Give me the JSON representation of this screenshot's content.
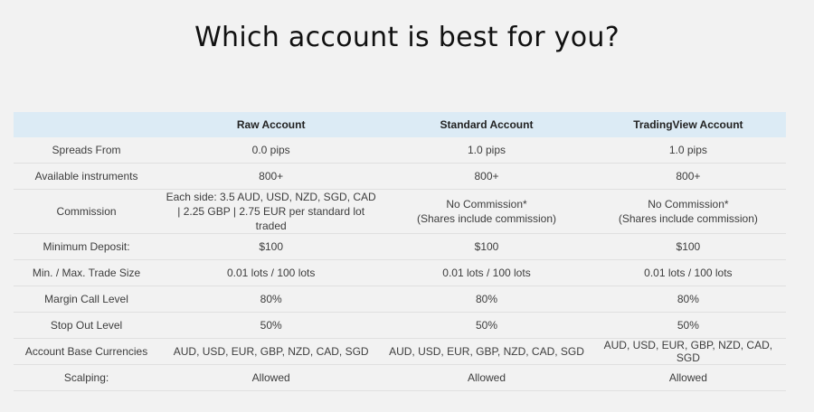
{
  "title": "Which account is best for you?",
  "table": {
    "headers": [
      "",
      "Raw Account",
      "Standard Account",
      "TradingView Account"
    ],
    "rows": [
      {
        "label": "Spreads From",
        "raw": "0.0 pips",
        "standard": "1.0 pips",
        "tradingview": "1.0 pips"
      },
      {
        "label": "Available instruments",
        "raw": "800+",
        "standard": "800+",
        "tradingview": "800+"
      },
      {
        "label": "Commission",
        "raw_lines": [
          "Each side: 3.5 AUD, USD, NZD, SGD, CAD",
          "| 2.25 GBP | 2.75 EUR per standard lot traded"
        ],
        "standard_lines": [
          "No Commission*",
          "(Shares include commission)"
        ],
        "tradingview_lines": [
          "No Commission*",
          "(Shares include commission)"
        ]
      },
      {
        "label": "Minimum Deposit:",
        "raw": "$100",
        "standard": "$100",
        "tradingview": "$100"
      },
      {
        "label": "Min. / Max. Trade Size",
        "raw": "0.01 lots / 100 lots",
        "standard": "0.01 lots / 100 lots",
        "tradingview": "0.01 lots / 100 lots"
      },
      {
        "label": "Margin Call Level",
        "raw": "80%",
        "standard": "80%",
        "tradingview": "80%"
      },
      {
        "label": "Stop Out Level",
        "raw": "50%",
        "standard": "50%",
        "tradingview": "50%"
      },
      {
        "label": "Account Base Currencies",
        "raw": "AUD, USD, EUR, GBP, NZD, CAD, SGD",
        "standard": "AUD, USD, EUR, GBP, NZD, CAD, SGD",
        "tradingview": "AUD, USD, EUR, GBP, NZD, CAD, SGD"
      },
      {
        "label": "Scalping:",
        "raw": "Allowed",
        "standard": "Allowed",
        "tradingview": "Allowed"
      }
    ]
  },
  "colors": {
    "header_background": "#dcebf5",
    "page_background": "#f2f2f2",
    "title_color": "#111111",
    "text_color": "#3d3d3d"
  }
}
